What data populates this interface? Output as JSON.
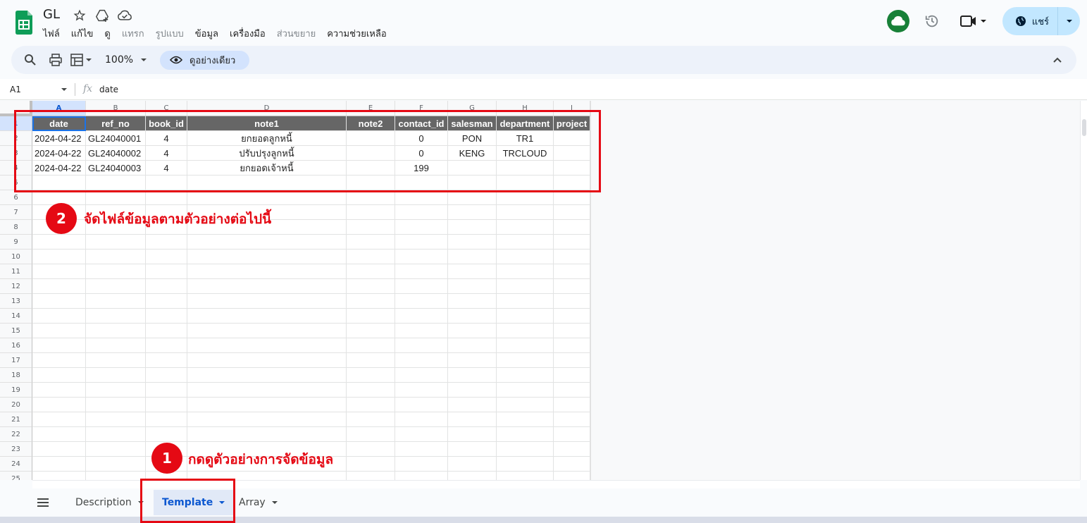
{
  "app": {
    "doc_title": "GL",
    "menu": [
      "ไฟล์",
      "แก้ไข",
      "ดู",
      "แทรก",
      "รูปแบบ",
      "ข้อมูล",
      "เครื่องมือ",
      "ส่วนขยาย",
      "ความช่วยเหลือ"
    ],
    "share_label": "แชร์"
  },
  "toolbar": {
    "zoom": "100%",
    "preview_label": "ดูอย่างเดียว"
  },
  "formula_bar": {
    "cell_ref": "A1",
    "fx": "fx",
    "content": "date"
  },
  "grid": {
    "columns": [
      {
        "letter": "A"
      },
      {
        "letter": "B"
      },
      {
        "letter": "C"
      },
      {
        "letter": "D"
      },
      {
        "letter": "E"
      },
      {
        "letter": "F"
      },
      {
        "letter": "G"
      },
      {
        "letter": "H"
      },
      {
        "letter": "I"
      }
    ],
    "row_numbers": [
      "1",
      "2",
      "3",
      "4",
      "5",
      "6",
      "7",
      "8",
      "9",
      "10",
      "11",
      "12",
      "13",
      "14",
      "15",
      "16",
      "17",
      "18",
      "19",
      "20",
      "21",
      "22",
      "23",
      "24",
      "25"
    ],
    "header": [
      "date",
      "ref_no",
      "book_id",
      "note1",
      "note2",
      "contact_id",
      "salesman",
      "department",
      "project"
    ],
    "rows": [
      [
        "2024-04-22",
        "GL24040001",
        "4",
        "ยกยอดลูกหนี้",
        "",
        "0",
        "PON",
        "TR1",
        ""
      ],
      [
        "2024-04-22",
        "GL24040002",
        "4",
        "ปรับปรุงลูกหนี้",
        "",
        "0",
        "KENG",
        "TRCLOUD",
        ""
      ],
      [
        "2024-04-22",
        "GL24040003",
        "4",
        "ยกยอดเจ้าหนี้",
        "",
        "199",
        "",
        "",
        ""
      ]
    ]
  },
  "sheets": {
    "tabs": [
      "Description",
      "Template",
      "Array"
    ],
    "active": "Template"
  },
  "annotations": {
    "step1_number": "1",
    "step1_text": "กดดูตัวอย่างการจัดข้อมูล",
    "step2_number": "2",
    "step2_text": "จัดไฟล์ข้อมูลตามตัวอย่างต่อไปนี้",
    "color": "#e50914"
  }
}
